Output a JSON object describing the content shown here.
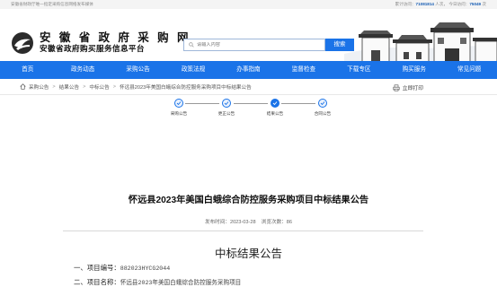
{
  "topbar": {
    "notice": "安徽省财政厅唯一指定采购信息网络发布媒体",
    "total_label": "累计访问：",
    "total_value": "71081814",
    "total_unit": "人次",
    "today_label": "今日访问：",
    "today_value": "75049",
    "today_unit": "次"
  },
  "header": {
    "title": "安 徽 省 政 府 采 购 网",
    "subtitle": "安徽省政府购买服务信息平台",
    "search_placeholder": "请输入内容",
    "search_button": "搜索"
  },
  "nav": [
    "首页",
    "政务动态",
    "采购公告",
    "政策法规",
    "办事指南",
    "监督检查",
    "下载专区",
    "购买服务",
    "常见问题"
  ],
  "breadcrumb": [
    "采购公告",
    "结果公告",
    "中标公告",
    "怀远县2023年美国白蛾综合防控服务采购项目中标结果公告"
  ],
  "print_label": "立即打印",
  "steps": [
    {
      "label": "采购公告",
      "state": "done"
    },
    {
      "label": "更正公告",
      "state": "done"
    },
    {
      "label": "结果公告",
      "state": "current"
    },
    {
      "label": "合同公告",
      "state": "done"
    }
  ],
  "article": {
    "title": "怀远县2023年美国白蛾综合防控服务采购项目中标结果公告",
    "date_label": "发布时间：",
    "date": "2023-03-28",
    "views_label": "浏览次数：",
    "views": "86",
    "doc_title": "中标结果公告",
    "fields": [
      {
        "label": "一、项目编号：",
        "value": "882023HYCG2044"
      },
      {
        "label": "二、项目名称：",
        "value": "怀远县2023年美国白蛾综合防控服务采购项目"
      }
    ]
  },
  "colors": {
    "brand": "#1a73e8",
    "stat": "#1a5fb4"
  }
}
